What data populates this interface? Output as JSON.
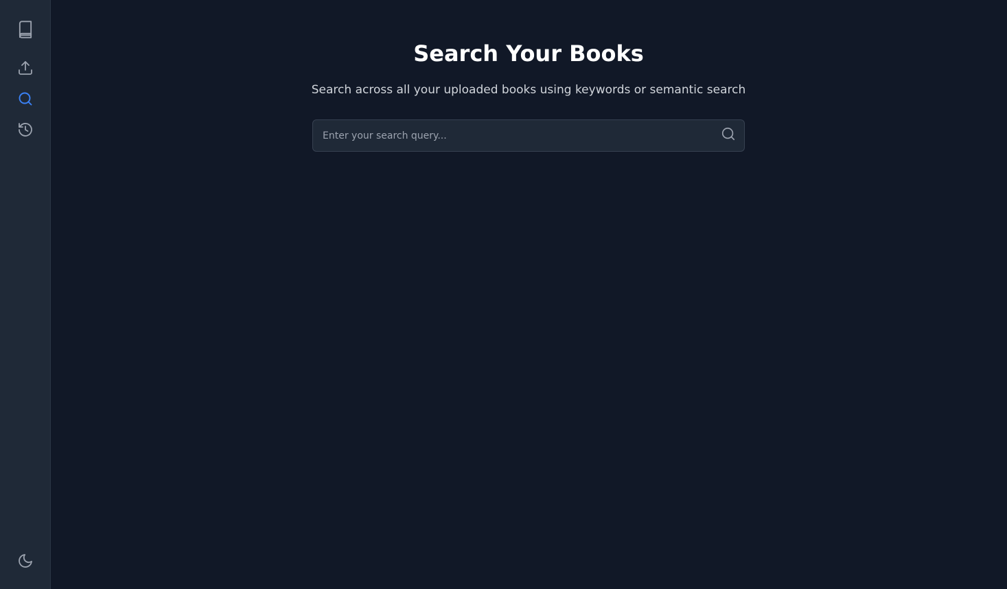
{
  "sidebar": {
    "items": [
      {
        "icon": "book-icon",
        "active": false
      },
      {
        "icon": "upload-icon",
        "active": false
      },
      {
        "icon": "search-icon",
        "active": true
      },
      {
        "icon": "history-icon",
        "active": false
      }
    ],
    "theme_toggle": {
      "icon": "moon-icon"
    }
  },
  "main": {
    "title": "Search Your Books",
    "subtitle": "Search across all your uploaded books using keywords or semantic search",
    "search": {
      "placeholder": "Enter your search query...",
      "value": "",
      "submit_icon": "search-icon"
    }
  },
  "colors": {
    "background": "#111827",
    "sidebar": "#1f2937",
    "accent": "#3b82f6",
    "icon": "#9ca3af",
    "title": "#ffffff",
    "subtitle": "#d1d5db"
  }
}
